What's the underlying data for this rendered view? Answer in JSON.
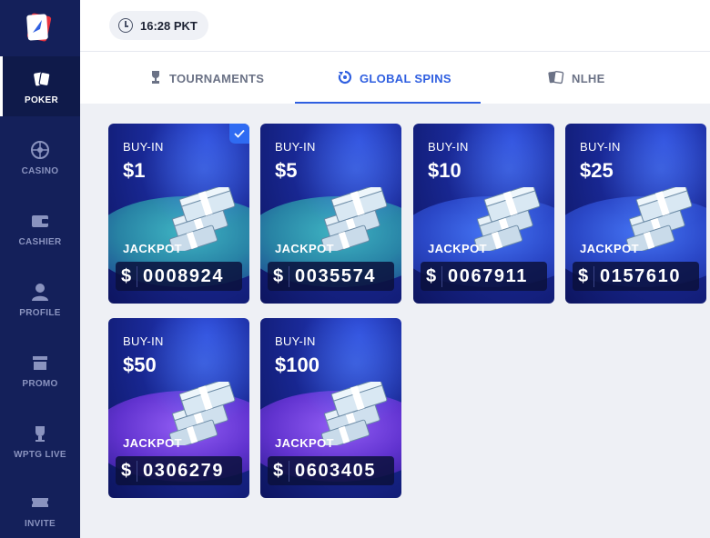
{
  "header": {
    "time": "16:28 PKT"
  },
  "sidebar": {
    "items": [
      {
        "label": "POKER",
        "icon": "poker-cards-icon",
        "active": true
      },
      {
        "label": "CASINO",
        "icon": "roulette-icon",
        "active": false
      },
      {
        "label": "CASHIER",
        "icon": "wallet-icon",
        "active": false
      },
      {
        "label": "PROFILE",
        "icon": "user-icon",
        "active": false
      },
      {
        "label": "PROMO",
        "icon": "gift-icon",
        "active": false
      },
      {
        "label": "WPTG LIVE",
        "icon": "trophy-icon",
        "active": false
      },
      {
        "label": "INVITE",
        "icon": "ticket-icon",
        "active": false
      }
    ]
  },
  "tabs": [
    {
      "label": "TOURNAMENTS",
      "icon": "trophy-icon",
      "active": false
    },
    {
      "label": "GLOBAL SPINS",
      "icon": "spin-icon",
      "active": true
    },
    {
      "label": "NLHE",
      "icon": "cards-icon",
      "active": false
    }
  ],
  "cards": [
    {
      "buyin_label": "BUY-IN",
      "buyin": "$1",
      "jackpot_label": "JACKPOT",
      "currency": "$",
      "jackpot": "0008924",
      "selected": true
    },
    {
      "buyin_label": "BUY-IN",
      "buyin": "$5",
      "jackpot_label": "JACKPOT",
      "currency": "$",
      "jackpot": "0035574",
      "selected": false
    },
    {
      "buyin_label": "BUY-IN",
      "buyin": "$10",
      "jackpot_label": "JACKPOT",
      "currency": "$",
      "jackpot": "0067911",
      "selected": false
    },
    {
      "buyin_label": "BUY-IN",
      "buyin": "$25",
      "jackpot_label": "JACKPOT",
      "currency": "$",
      "jackpot": "0157610",
      "selected": false
    },
    {
      "buyin_label": "BUY-IN",
      "buyin": "$50",
      "jackpot_label": "JACKPOT",
      "currency": "$",
      "jackpot": "0306279",
      "selected": false
    },
    {
      "buyin_label": "BUY-IN",
      "buyin": "$100",
      "jackpot_label": "JACKPOT",
      "currency": "$",
      "jackpot": "0603405",
      "selected": false
    }
  ],
  "colors": {
    "sidebar_bg": "#14205a",
    "accent": "#2f5fe0",
    "card_bg": "#1a2a9a"
  }
}
